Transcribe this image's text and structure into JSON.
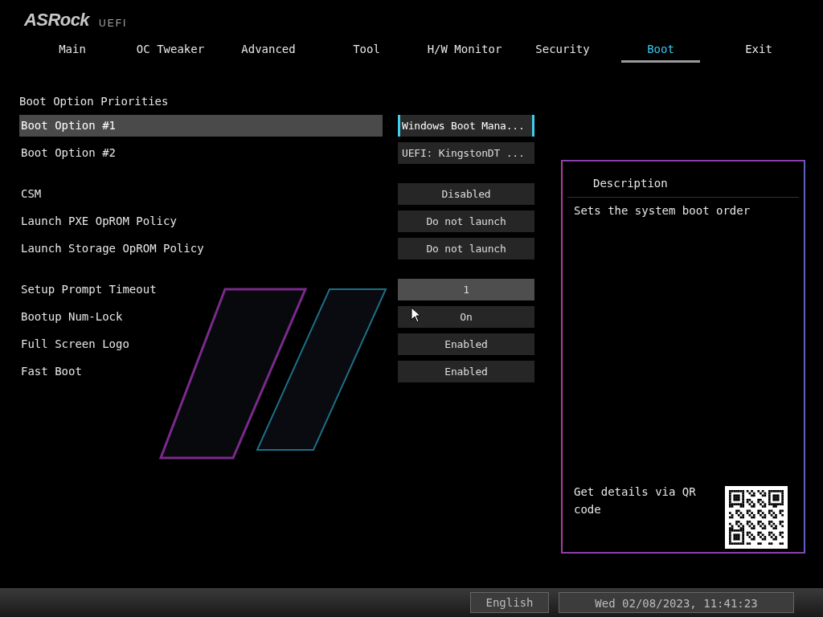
{
  "brand": {
    "logo": "ASRock",
    "subtitle": "UEFI"
  },
  "tabs": [
    {
      "label": "Main",
      "selected": false
    },
    {
      "label": "OC Tweaker",
      "selected": false
    },
    {
      "label": "Advanced",
      "selected": false
    },
    {
      "label": "Tool",
      "selected": false
    },
    {
      "label": "H/W Monitor",
      "selected": false
    },
    {
      "label": "Security",
      "selected": false
    },
    {
      "label": "Boot",
      "selected": true
    },
    {
      "label": "Exit",
      "selected": false
    }
  ],
  "groups": [
    {
      "title": "Boot Option Priorities",
      "items": [
        {
          "label": "Boot Option #1",
          "value": "Windows Boot Mana...",
          "selected": true,
          "hovered": false
        },
        {
          "label": "Boot Option #2",
          "value": "UEFI: KingstonDT ...",
          "selected": false,
          "hovered": false
        }
      ]
    },
    {
      "items": [
        {
          "label": "CSM",
          "value": "Disabled",
          "selected": false,
          "hovered": false
        },
        {
          "label": "Launch PXE OpROM Policy",
          "value": "Do not launch",
          "selected": false,
          "hovered": false
        },
        {
          "label": "Launch Storage OpROM Policy",
          "value": "Do not launch",
          "selected": false,
          "hovered": false
        }
      ]
    },
    {
      "items": [
        {
          "label": "Setup Prompt Timeout",
          "value": "1",
          "selected": false,
          "hovered": true
        },
        {
          "label": "Bootup Num-Lock",
          "value": "On",
          "selected": false,
          "hovered": false
        },
        {
          "label": "Full Screen Logo",
          "value": "Enabled",
          "selected": false,
          "hovered": false
        },
        {
          "label": "Fast Boot",
          "value": "Enabled",
          "selected": false,
          "hovered": false
        }
      ]
    }
  ],
  "description": {
    "title": "Description",
    "text": "Sets the system boot order",
    "qr_text": "Get details via QR code"
  },
  "status_bar": {
    "language": "English",
    "datetime": "Wed 02/08/2023, 11:41:23"
  }
}
